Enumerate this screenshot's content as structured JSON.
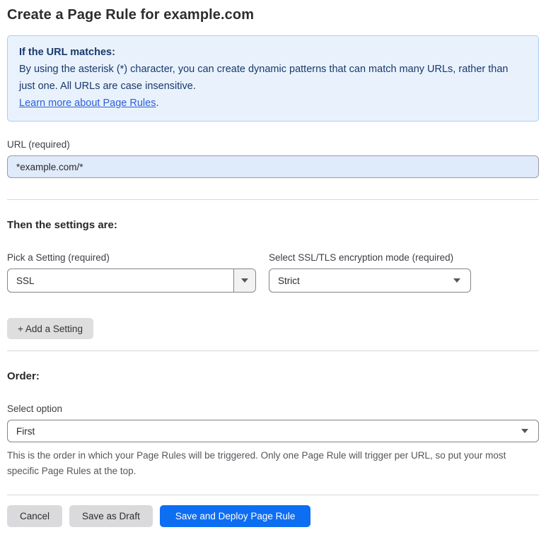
{
  "page": {
    "title": "Create a Page Rule for example.com"
  },
  "callout": {
    "heading": "If the URL matches:",
    "body": "By using the asterisk (*) character, you can create dynamic patterns that can match many URLs, rather than just one. All URLs are case insensitive.",
    "link_label": "Learn more about Page Rules",
    "link_suffix": "."
  },
  "url_field": {
    "label": "URL (required)",
    "value": "*example.com/*"
  },
  "settings": {
    "heading": "Then the settings are:",
    "setting_picker": {
      "label": "Pick a Setting (required)",
      "value": "SSL"
    },
    "mode_picker": {
      "label": "Select SSL/TLS encryption mode (required)",
      "value": "Strict"
    },
    "add_button_label": "+ Add a Setting"
  },
  "order": {
    "heading": "Order:",
    "label": "Select option",
    "value": "First",
    "help": "This is the order in which your Page Rules will be triggered. Only one Page Rule will trigger per URL, so put your most specific Page Rules at the top."
  },
  "footer": {
    "cancel_label": "Cancel",
    "save_draft_label": "Save as Draft",
    "save_deploy_label": "Save and Deploy Page Rule"
  },
  "colors": {
    "accent_blue": "#0d6ef2",
    "callout_bg": "#e9f2fc",
    "callout_border": "#a9cdf1",
    "callout_text": "#19386c",
    "link_blue": "#2b5fd9",
    "url_input_bg": "#dfeafa",
    "gray_button_bg": "#dadadd",
    "divider": "#d7d7d9"
  }
}
